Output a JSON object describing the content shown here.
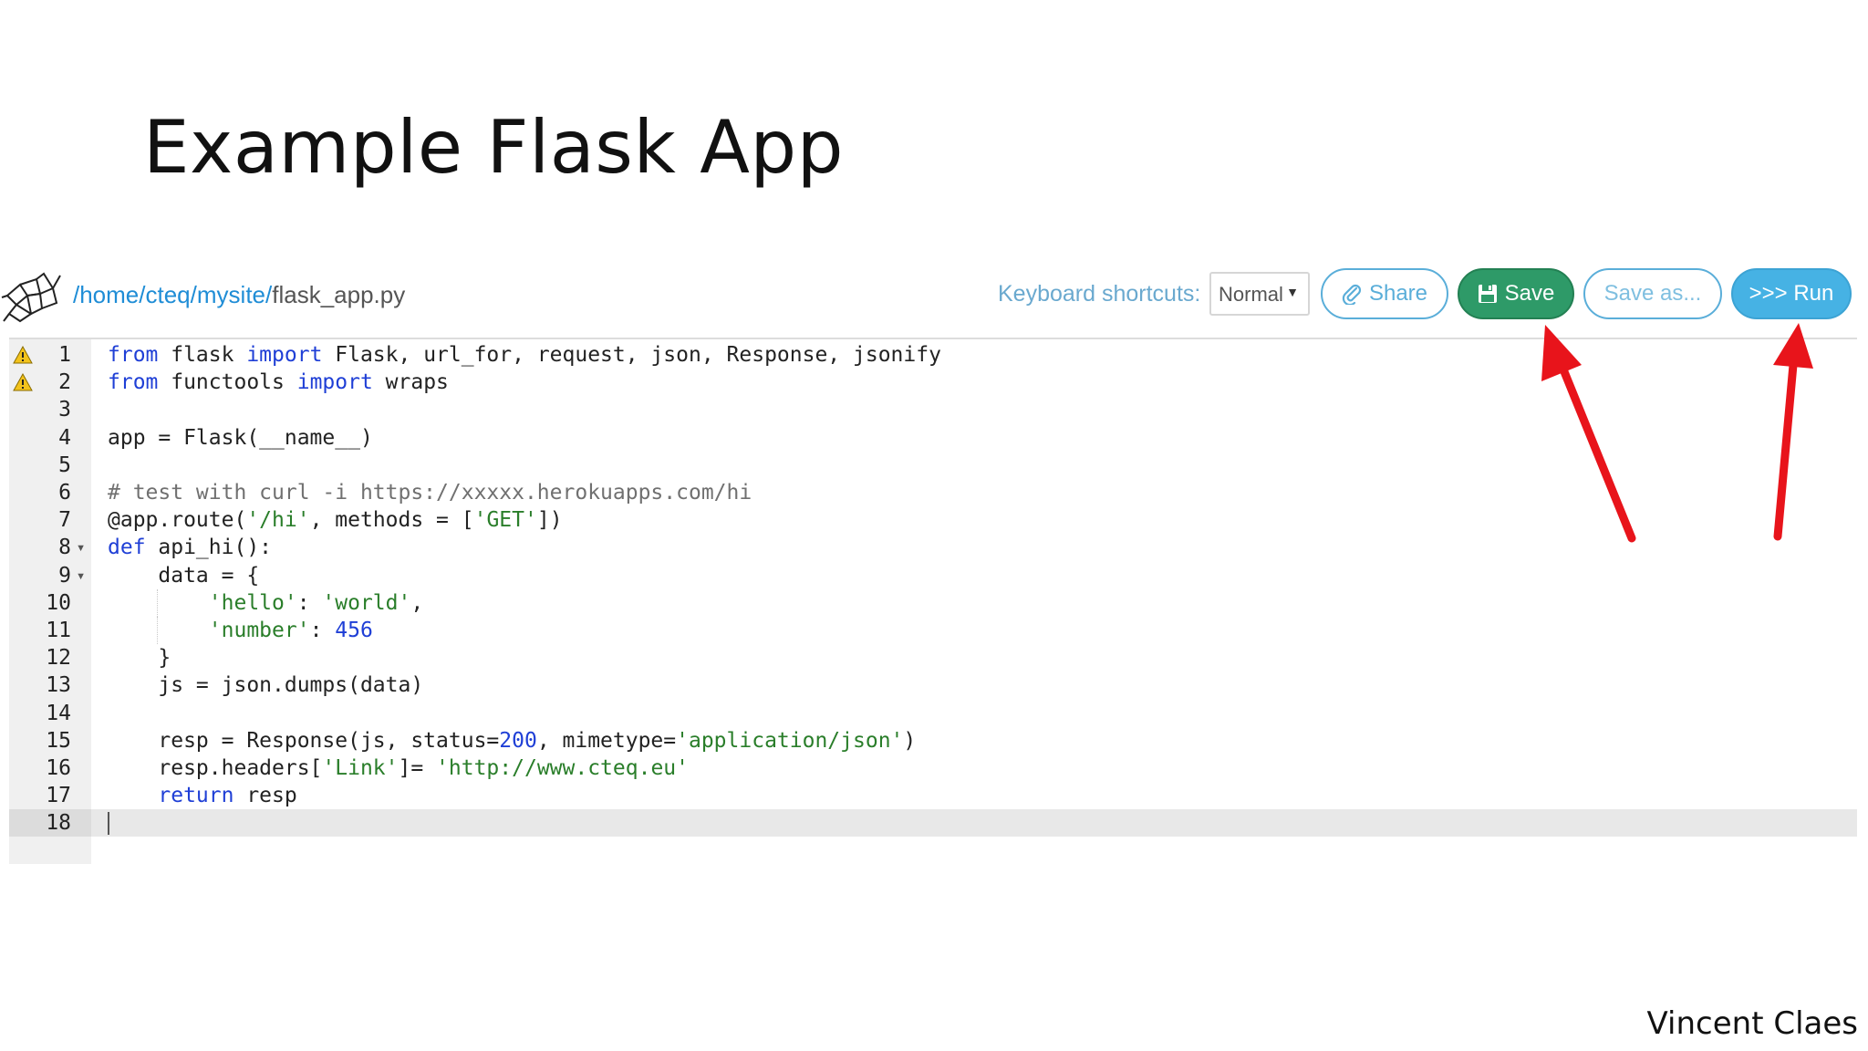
{
  "slide": {
    "title": "Example Flask App",
    "author": "Vincent Claes"
  },
  "toolbar": {
    "path": {
      "root": "/home/",
      "user": "cteq",
      "sep": "/",
      "site": "mysite",
      "file": "flask_app.py"
    },
    "keyboard_label": "Keyboard shortcuts:",
    "keyboard_mode": "Normal",
    "share_label": "Share",
    "save_label": "Save",
    "saveas_label": "Save as...",
    "run_label": ">>> Run"
  },
  "editor": {
    "active_line": 18,
    "lines": [
      {
        "n": "1",
        "warn": true,
        "fold": false
      },
      {
        "n": "2",
        "warn": true,
        "fold": false
      },
      {
        "n": "3",
        "warn": false,
        "fold": false
      },
      {
        "n": "4",
        "warn": false,
        "fold": false
      },
      {
        "n": "5",
        "warn": false,
        "fold": false
      },
      {
        "n": "6",
        "warn": false,
        "fold": false
      },
      {
        "n": "7",
        "warn": false,
        "fold": false
      },
      {
        "n": "8",
        "warn": false,
        "fold": true
      },
      {
        "n": "9",
        "warn": false,
        "fold": true
      },
      {
        "n": "10",
        "warn": false,
        "fold": false
      },
      {
        "n": "11",
        "warn": false,
        "fold": false
      },
      {
        "n": "12",
        "warn": false,
        "fold": false
      },
      {
        "n": "13",
        "warn": false,
        "fold": false
      },
      {
        "n": "14",
        "warn": false,
        "fold": false
      },
      {
        "n": "15",
        "warn": false,
        "fold": false
      },
      {
        "n": "16",
        "warn": false,
        "fold": false
      },
      {
        "n": "17",
        "warn": false,
        "fold": false
      },
      {
        "n": "18",
        "warn": false,
        "fold": false
      }
    ],
    "code": [
      [
        [
          "kw",
          "from"
        ],
        [
          "t",
          " flask "
        ],
        [
          "kw",
          "import"
        ],
        [
          "t",
          " Flask, url_for, request, json, Response, jsonify"
        ]
      ],
      [
        [
          "kw",
          "from"
        ],
        [
          "t",
          " functools "
        ],
        [
          "kw",
          "import"
        ],
        [
          "t",
          " wraps"
        ]
      ],
      [],
      [
        [
          "t",
          "app = Flask(__name__)"
        ]
      ],
      [],
      [
        [
          "cm",
          "# test with curl -i https://xxxxx.herokuapps.com/hi"
        ]
      ],
      [
        [
          "t",
          "@app.route("
        ],
        [
          "str",
          "'/hi'"
        ],
        [
          "t",
          ", methods = ["
        ],
        [
          "str",
          "'GET'"
        ],
        [
          "t",
          "])"
        ]
      ],
      [
        [
          "kw",
          "def"
        ],
        [
          "t",
          " api_hi():"
        ]
      ],
      [
        [
          "t",
          "    data = {"
        ]
      ],
      [
        [
          "t",
          "        "
        ],
        [
          "str",
          "'hello'"
        ],
        [
          "t",
          ": "
        ],
        [
          "str",
          "'world'"
        ],
        [
          "t",
          ","
        ]
      ],
      [
        [
          "t",
          "        "
        ],
        [
          "str",
          "'number'"
        ],
        [
          "t",
          ": "
        ],
        [
          "num",
          "456"
        ]
      ],
      [
        [
          "t",
          "    }"
        ]
      ],
      [
        [
          "t",
          "    js = json.dumps(data)"
        ]
      ],
      [],
      [
        [
          "t",
          "    resp = Response(js, status="
        ],
        [
          "num",
          "200"
        ],
        [
          "t",
          ", mimetype="
        ],
        [
          "str",
          "'application/json'"
        ],
        [
          "t",
          ")"
        ]
      ],
      [
        [
          "t",
          "    resp.headers["
        ],
        [
          "str",
          "'Link'"
        ],
        [
          "t",
          "]= "
        ],
        [
          "str",
          "'http://www.cteq.eu'"
        ]
      ],
      [
        [
          "t",
          "    "
        ],
        [
          "kw",
          "return"
        ],
        [
          "t",
          " resp"
        ]
      ],
      []
    ]
  },
  "colors": {
    "save_bg": "#2e9a68",
    "run_bg": "#46b2e4",
    "accent_blue": "#1f8dd6",
    "arrow_red": "#e8141b"
  }
}
